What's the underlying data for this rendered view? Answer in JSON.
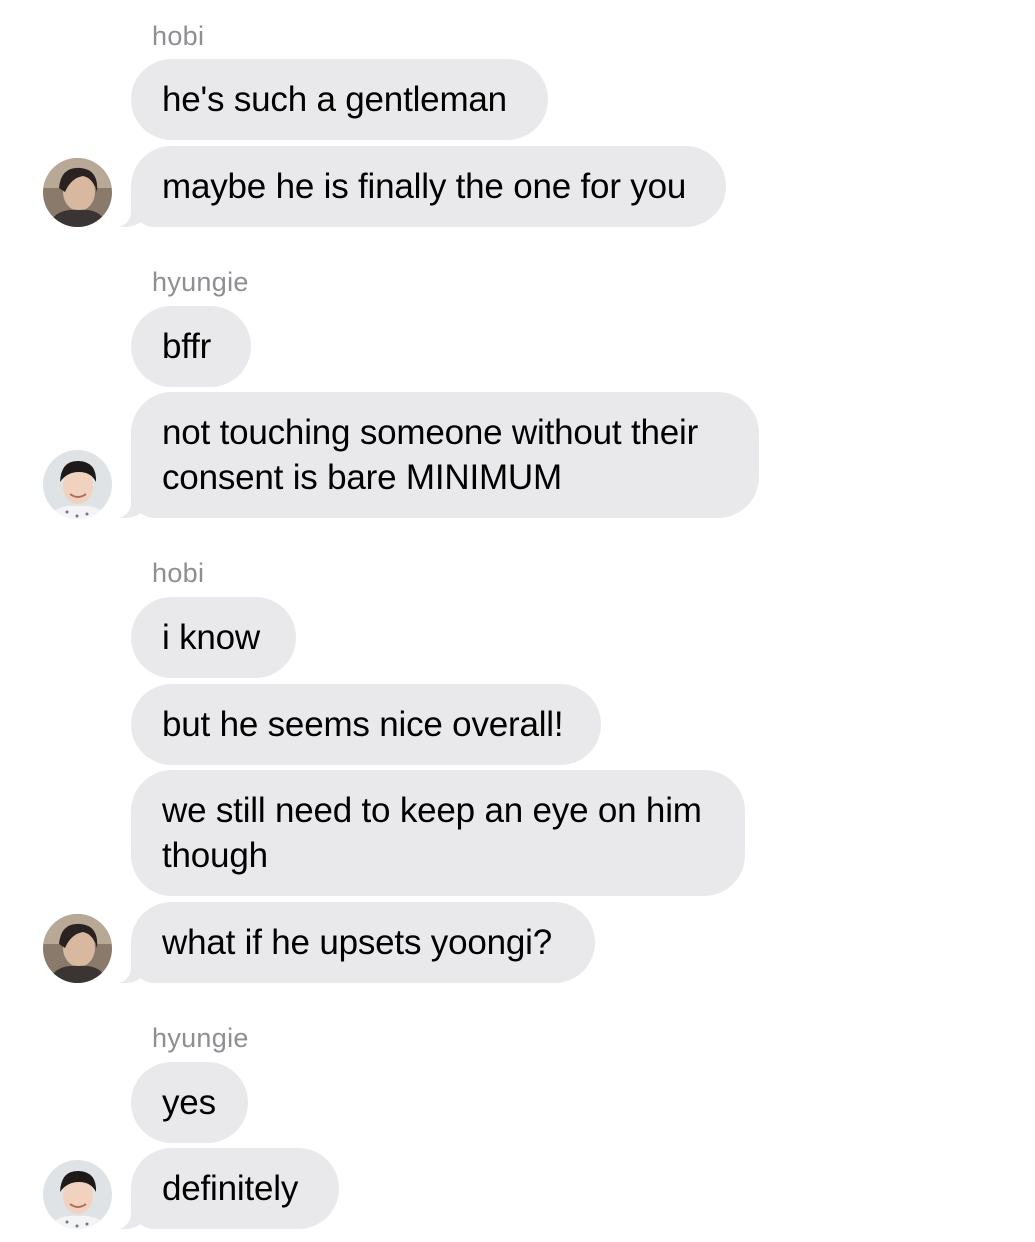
{
  "participants": {
    "hobi": {
      "avatar_icon": "dark-haired-person-avatar-icon"
    },
    "hyungie": {
      "avatar_icon": "smiling-person-avatar-icon"
    }
  },
  "messages": [
    {
      "sender": "hobi",
      "texts": [
        "he's such a gentleman",
        "maybe he is finally the one for you"
      ]
    },
    {
      "sender": "hyungie",
      "texts": [
        "bffr",
        "not touching someone without their\nconsent is bare MINIMUM"
      ]
    },
    {
      "sender": "hobi",
      "texts": [
        "i know",
        "but he seems nice overall!",
        "we still need to keep an eye on him\nthough",
        "what if he upsets yoongi?"
      ]
    },
    {
      "sender": "hyungie",
      "texts": [
        "yes",
        "definitely"
      ]
    }
  ],
  "colors": {
    "bubble_bg": "#e9e9eb",
    "sender_label": "#8e8e93",
    "background": "#ffffff"
  }
}
